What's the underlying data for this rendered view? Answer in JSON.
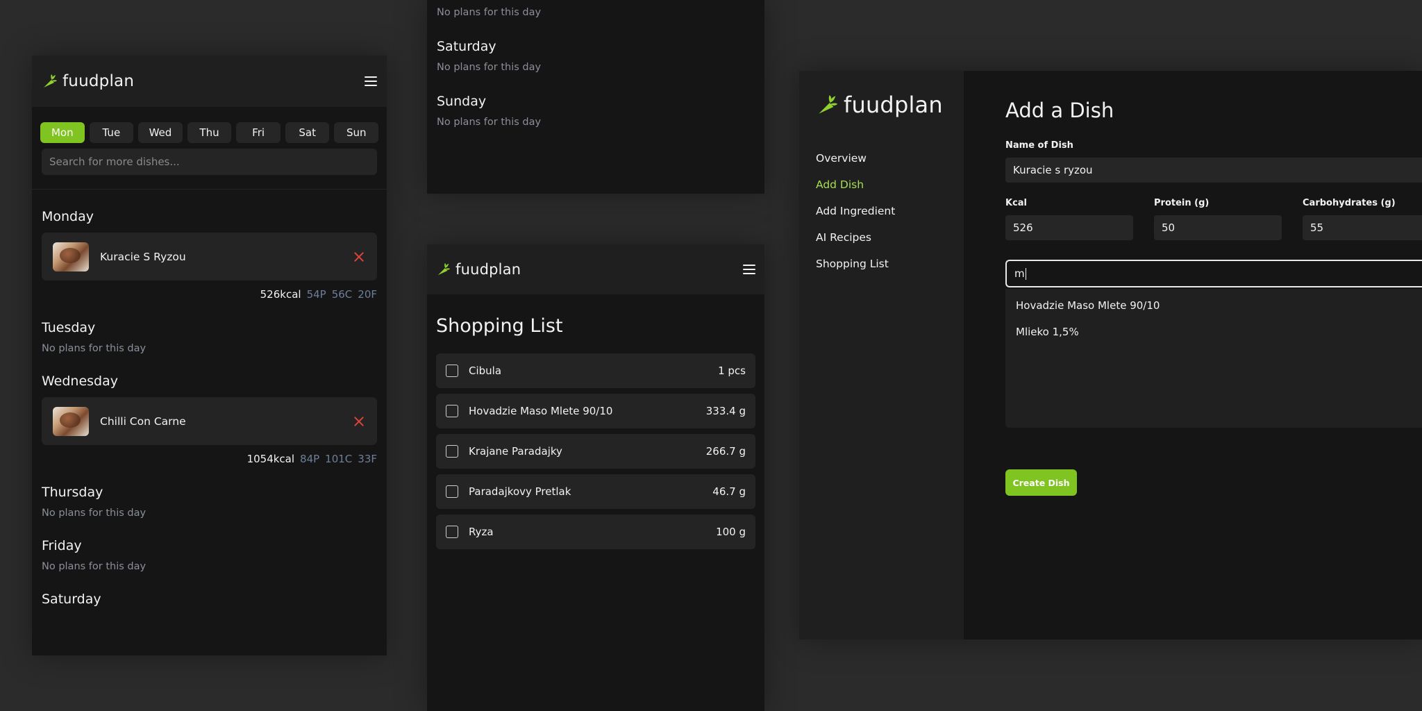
{
  "app": {
    "name": "fuudplan"
  },
  "colors": {
    "accent": "#7fc421",
    "accent_text": "#a6de52",
    "danger": "#e0433c",
    "macro_muted": "#6e7f9a"
  },
  "week": {
    "tabs": [
      "Mon",
      "Tue",
      "Wed",
      "Thu",
      "Fri",
      "Sat",
      "Sun"
    ],
    "active_tab": "Mon",
    "search_placeholder": "Search for more dishes...",
    "empty_text": "No plans for this day",
    "days": {
      "monday": {
        "name": "Monday",
        "dish": "Kuracie S Ryzou",
        "kcal": "526kcal",
        "p": "54P",
        "c": "56C",
        "f": "20F"
      },
      "tuesday": {
        "name": "Tuesday"
      },
      "wednesday": {
        "name": "Wednesday",
        "dish": "Chilli Con Carne",
        "kcal": "1054kcal",
        "p": "84P",
        "c": "101C",
        "f": "33F"
      },
      "thursday": {
        "name": "Thursday"
      },
      "friday": {
        "name": "Friday"
      },
      "saturday": {
        "name": "Saturday"
      },
      "sunday": {
        "name": "Sunday"
      }
    }
  },
  "shopping": {
    "title": "Shopping List",
    "items": [
      {
        "name": "Cibula",
        "qty": "1 pcs"
      },
      {
        "name": "Hovadzie Maso Mlete 90/10",
        "qty": "333.4 g"
      },
      {
        "name": "Krajane Paradajky",
        "qty": "266.7 g"
      },
      {
        "name": "Paradajkovy Pretlak",
        "qty": "46.7 g"
      },
      {
        "name": "Ryza",
        "qty": "100 g"
      }
    ]
  },
  "desktop": {
    "nav": [
      "Overview",
      "Add Dish",
      "Add Ingredient",
      "AI Recipes",
      "Shopping List"
    ],
    "active_nav": "Add Dish",
    "title": "Add a Dish",
    "name_label": "Name of Dish",
    "name_value": "Kuracie s ryzou",
    "kcal_label": "Kcal",
    "kcal_value": "526",
    "protein_label": "Protein (g)",
    "protein_value": "50",
    "carbs_label": "Carbohydrates (g)",
    "carbs_value": "55",
    "ingredient_query": "m",
    "suggestions": [
      "Hovadzie Maso Mlete 90/10",
      "Mlieko 1,5%"
    ],
    "create_label": "Create Dish"
  }
}
